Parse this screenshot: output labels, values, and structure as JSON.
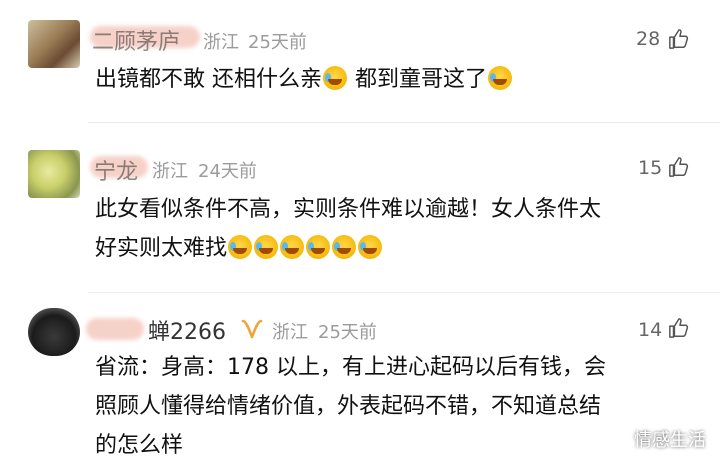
{
  "comments": [
    {
      "username": "二顾茅庐",
      "location": "浙江",
      "time": "25天前",
      "likes": "28",
      "segments": [
        "出镜都不敢 还相什么亲",
        "都到童哥这了"
      ],
      "emoji_counts": [
        1,
        1
      ]
    },
    {
      "username": "宁龙",
      "location": "浙江",
      "time": "24天前",
      "likes": "15",
      "lines": [
        "此女看似条件不高，实则条件难以逾越！女人条件太",
        "好实则太难找"
      ],
      "emoji_count": 6
    },
    {
      "username": "蝉2266",
      "location": "浙江",
      "time": "25天前",
      "likes": "14",
      "lines": [
        "省流：身高：178 以上，有上进心起码以后有钱，会",
        "照顾人懂得给情绪价值，外表起码不错，不知道总结",
        "的怎么样"
      ]
    }
  ],
  "icons": {
    "like": "thumbs-up-icon",
    "emoji": "laughing-crying-emoji-icon",
    "vip": "vip-badge-icon"
  },
  "colors": {
    "meta_gray": "#9b9b9b",
    "vip_orange": "#f0a53a"
  },
  "watermark": "情感生活"
}
